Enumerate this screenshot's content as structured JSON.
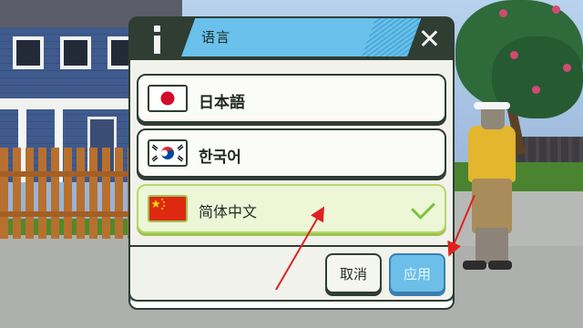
{
  "dialog": {
    "title": "语言",
    "languages": [
      {
        "label": "日本語",
        "flag": "japan-flag",
        "selected": false
      },
      {
        "label": "한국어",
        "flag": "south-korea-flag",
        "selected": false
      },
      {
        "label": "简体中文",
        "flag": "china-flag",
        "selected": true
      }
    ],
    "cancel_label": "取消",
    "apply_label": "应用"
  },
  "colors": {
    "panel_dark": "#2f3d33",
    "accent_blue": "#69c1ec",
    "selected_green": "#b6d86a",
    "check_green": "#7fbf3f",
    "annotation_red": "#e02020"
  }
}
